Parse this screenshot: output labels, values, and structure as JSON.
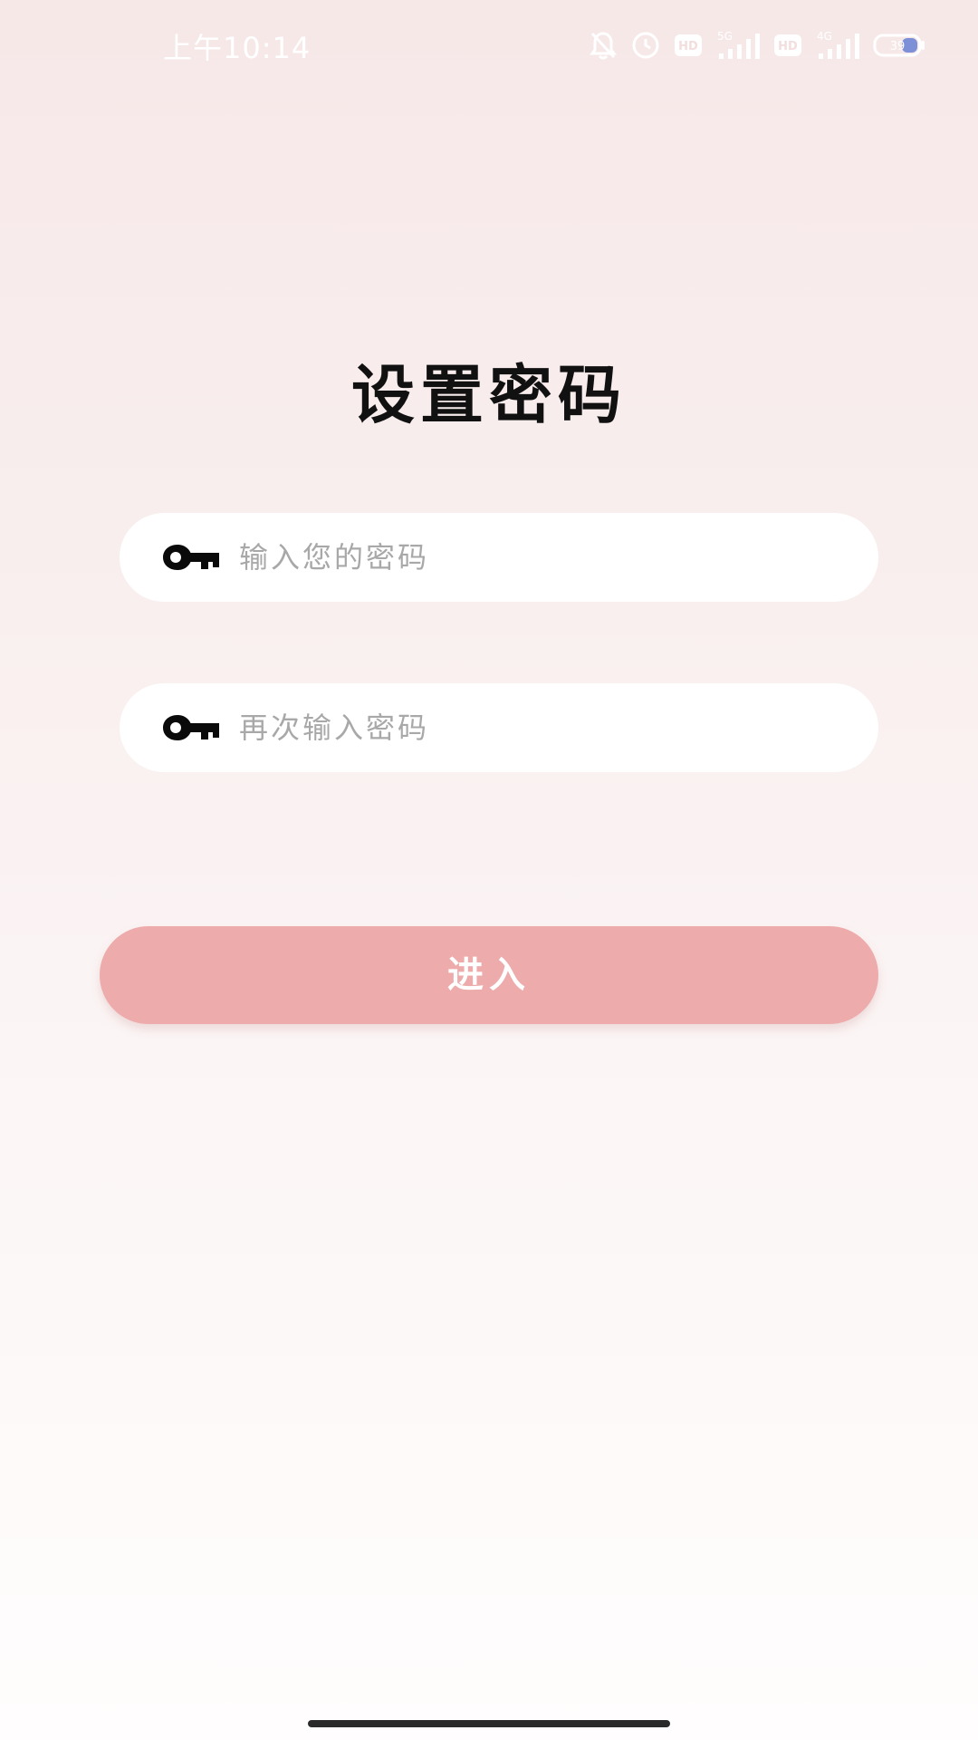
{
  "status_bar": {
    "time": "上午10:14",
    "network_1": "5G",
    "network_2": "4G",
    "hd_1": "HD",
    "hd_2": "HD",
    "battery_level": "39",
    "icons": [
      "bell-off-icon",
      "alarm-icon",
      "hd-icon",
      "signal-icon",
      "hd-icon",
      "signal-icon",
      "battery-icon"
    ]
  },
  "page": {
    "title": "设置密码"
  },
  "form": {
    "password_placeholder": "输入您的密码",
    "confirm_placeholder": "再次输入密码",
    "password_value": "",
    "confirm_value": "",
    "field_icon": "key-icon",
    "submit_label": "进入"
  },
  "colors": {
    "button_bg": "#eeabab",
    "field_bg": "#ffffff",
    "title": "#111111",
    "placeholder": "#a8a8a8"
  }
}
